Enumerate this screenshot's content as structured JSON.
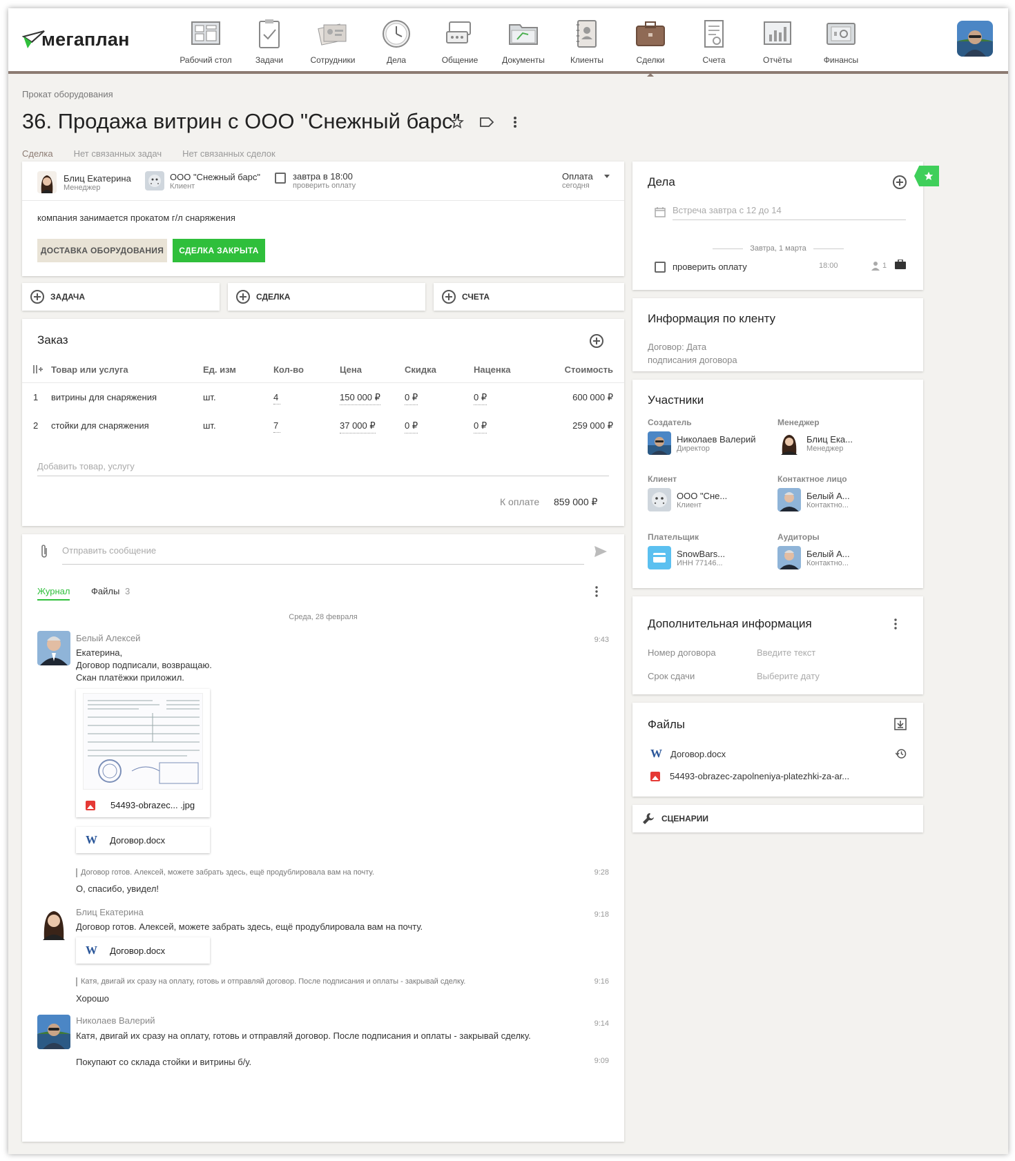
{
  "app": {
    "logo_text": "мегаплан"
  },
  "nav": [
    {
      "label": "Рабочий стол",
      "icon": "desktop-icon"
    },
    {
      "label": "Задачи",
      "icon": "tasks-icon"
    },
    {
      "label": "Сотрудники",
      "icon": "employees-icon"
    },
    {
      "label": "Дела",
      "icon": "clock-icon"
    },
    {
      "label": "Общение",
      "icon": "chat-icon"
    },
    {
      "label": "Документы",
      "icon": "folder-icon"
    },
    {
      "label": "Клиенты",
      "icon": "contacts-icon"
    },
    {
      "label": "Сделки",
      "icon": "briefcase-icon"
    },
    {
      "label": "Счета",
      "icon": "invoice-icon"
    },
    {
      "label": "Отчёты",
      "icon": "reports-icon"
    },
    {
      "label": "Финансы",
      "icon": "safe-icon"
    }
  ],
  "breadcrumb": "Прокат оборудования",
  "title": "36. Продажа витрин с ООО \"Снежный барс\"",
  "tabs": [
    "Сделка",
    "Нет связанных задач",
    "Нет связанных сделок"
  ],
  "deal": {
    "manager_name": "Блиц Екатерина",
    "manager_role": "Менеджер",
    "client_name": "ООО \"Снежный барс\"",
    "client_role": "Клиент",
    "todo_title": "завтра в 18:00",
    "todo_sub": "проверить оплату",
    "stage_title": "Оплата",
    "stage_sub": "сегодня",
    "description": "компания занимается прокатом г/л снаряжения",
    "btn_delivery": "ДОСТАВКА ОБОРУДОВАНИЯ",
    "btn_closed": "СДЕЛКА ЗАКРЫТА"
  },
  "quick_add": [
    "ЗАДАЧА",
    "СДЕЛКА",
    "СЧЕТА"
  ],
  "order": {
    "title": "Заказ",
    "headers": [
      "Товар или услуга",
      "Ед. изм",
      "Кол-во",
      "Цена",
      "Скидка",
      "Наценка",
      "Стоимость"
    ],
    "rows": [
      {
        "n": "1",
        "name": "витрины для снаряжения",
        "unit": "шт.",
        "qty": "4",
        "price": "150 000 ₽",
        "discount": "0 ₽",
        "markup": "0 ₽",
        "total": "600 000 ₽"
      },
      {
        "n": "2",
        "name": "стойки для снаряжения",
        "unit": "шт.",
        "qty": "7",
        "price": "37 000 ₽",
        "discount": "0 ₽",
        "markup": "0 ₽",
        "total": "259 000 ₽"
      }
    ],
    "add_placeholder": "Добавить товар, услугу",
    "to_pay_label": "К оплате",
    "to_pay_value": "859 000 ₽"
  },
  "message": {
    "placeholder": "Отправить сообщение"
  },
  "journal": {
    "tab_journal": "Журнал",
    "tab_files": "Файлы",
    "files_count": "3",
    "date": "Среда, 28 февраля",
    "entries": [
      {
        "author": "Белый Алексей",
        "time": "9:43",
        "lines": [
          "Екатерина,",
          "Договор подписали, возвращаю.",
          "Скан платёжки приложил."
        ]
      },
      {
        "quote": "Договор готов. Алексей, можете забрать здесь, ещё продублировала вам на почту.",
        "time": "9:28",
        "text": "О, спасибо, увидел!"
      },
      {
        "author": "Блиц Екатерина",
        "time": "9:18",
        "text": "Договор готов. Алексей, можете забрать здесь, ещё продублировала вам на почту."
      },
      {
        "quote": "Катя, двигай их сразу на оплату, готовь и отправляй договор. После подписания и оплаты - закрывай сделку.",
        "time": "9:16",
        "text": "Хорошо"
      },
      {
        "author": "Николаев Валерий",
        "time": "9:14",
        "text": "Катя, двигай их сразу на оплату, готовь и отправляй договор. После подписания и оплаты - закрывай сделку."
      },
      {
        "time": "9:09",
        "text": "Покупают со склада стойки и витрины б/у."
      }
    ],
    "file_jpg": "54493-obrazec... .jpg",
    "file_docx": "Договор.docx"
  },
  "affairs": {
    "title": "Дела",
    "placeholder": "Встреча завтра с 12 до 14",
    "divider": "Завтра, 1 марта",
    "item": "проверить оплату",
    "item_time": "18:00",
    "item_count": "1"
  },
  "client_info": {
    "title": "Информация по кленту",
    "text": "Договор: Дата подписания договора"
  },
  "participants": {
    "title": "Участники",
    "items": [
      {
        "label": "Создатель",
        "name": "Николаев Валерий",
        "sub": "Директор"
      },
      {
        "label": "Менеджер",
        "name": "Блиц Ека...",
        "sub": "Менеджер"
      },
      {
        "label": "Клиент",
        "name": "ООО \"Сне...",
        "sub": "Клиент"
      },
      {
        "label": "Контактное лицо",
        "name": "Белый А...",
        "sub": "Контактно..."
      },
      {
        "label": "Плательщик",
        "name": "SnowBars...",
        "sub": "ИНН 77146..."
      },
      {
        "label": "Аудиторы",
        "name": "Белый А...",
        "sub": "Контактно..."
      }
    ]
  },
  "extra_info": {
    "title": "Дополнительная информация",
    "rows": [
      {
        "label": "Номер договора",
        "value": "Введите текст"
      },
      {
        "label": "Срок сдачи",
        "value": "Выберите дату"
      }
    ]
  },
  "files": {
    "title": "Файлы",
    "items": [
      "Договор.docx",
      "54493-obrazec-zapolneniya-platezhki-za-ar..."
    ]
  },
  "scenarios": "СЦЕНАРИИ",
  "colors": {
    "accent_green": "#2fbf3b",
    "brand_brown": "#8c7b72",
    "beige_button": "#e9e3d6"
  }
}
